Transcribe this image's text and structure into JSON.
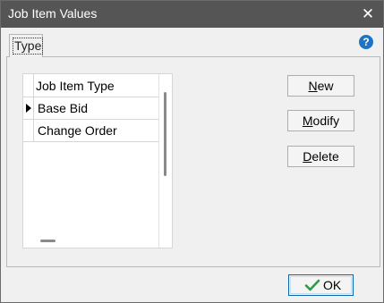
{
  "window": {
    "title": "Job Item Values",
    "close_glyph": "✕"
  },
  "tabs": [
    {
      "label": "Type",
      "selected": true
    }
  ],
  "help": {
    "glyph": "?",
    "icon": "help-icon",
    "color": "#1f73c4"
  },
  "grid": {
    "column_header": "Job Item Type",
    "rows": [
      {
        "label": "Base Bid",
        "current": true
      },
      {
        "label": "Change Order",
        "current": false
      }
    ]
  },
  "buttons": {
    "new": {
      "mnemonic": "N",
      "rest": "ew"
    },
    "modify": {
      "mnemonic": "M",
      "rest": "odify"
    },
    "delete": {
      "mnemonic": "D",
      "rest": "elete"
    }
  },
  "footer": {
    "ok_label": "OK",
    "ok_icon": "check-icon",
    "ok_icon_color": "#2e9b48"
  },
  "colors": {
    "titlebar": "#555555",
    "window_bg": "#f0f0f0",
    "ok_border": "#0a64ad"
  }
}
